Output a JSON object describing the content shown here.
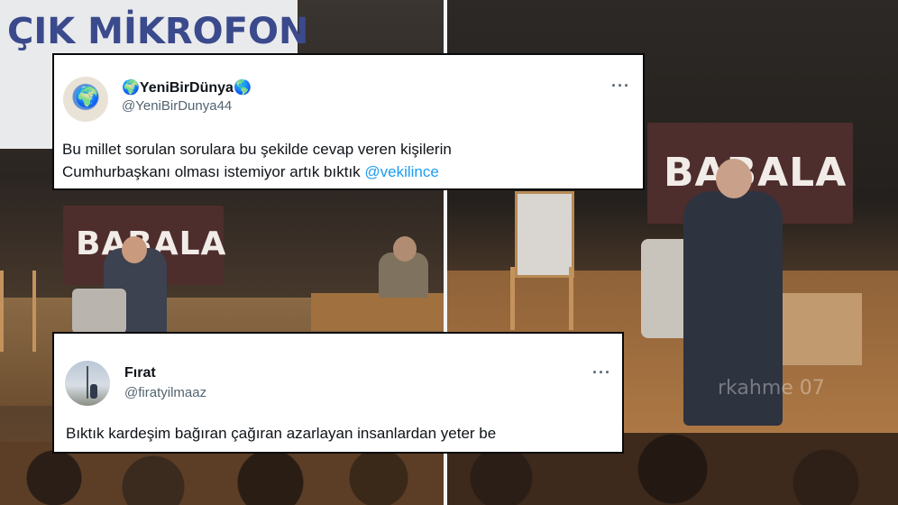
{
  "left_scene": {
    "screen_text": "ÇIK MİKROFON",
    "banner_text": "BABALA"
  },
  "right_scene": {
    "banner_text": "BABALA",
    "watermark": "rkahme 07"
  },
  "tweets": [
    {
      "display_name": "🌍YeniBirDünya🌎",
      "handle": "@YeniBirDunya44",
      "more_label": "···",
      "text_line1": "Bu millet sorulan sorulara bu şekilde cevap veren kişilerin",
      "text_line2": "Cumhurbaşkanı olması istemiyor artık bıktık ",
      "mention": "@vekilince"
    },
    {
      "display_name": "Fırat",
      "handle": "@firatyilmaaz",
      "more_label": "···",
      "text": "Bıktık kardeşim bağıran çağıran azarlayan insanlardan yeter be"
    }
  ],
  "colors": {
    "banner": "#4e2d2d",
    "mention": "#1d9bf0",
    "handle": "#536471"
  }
}
